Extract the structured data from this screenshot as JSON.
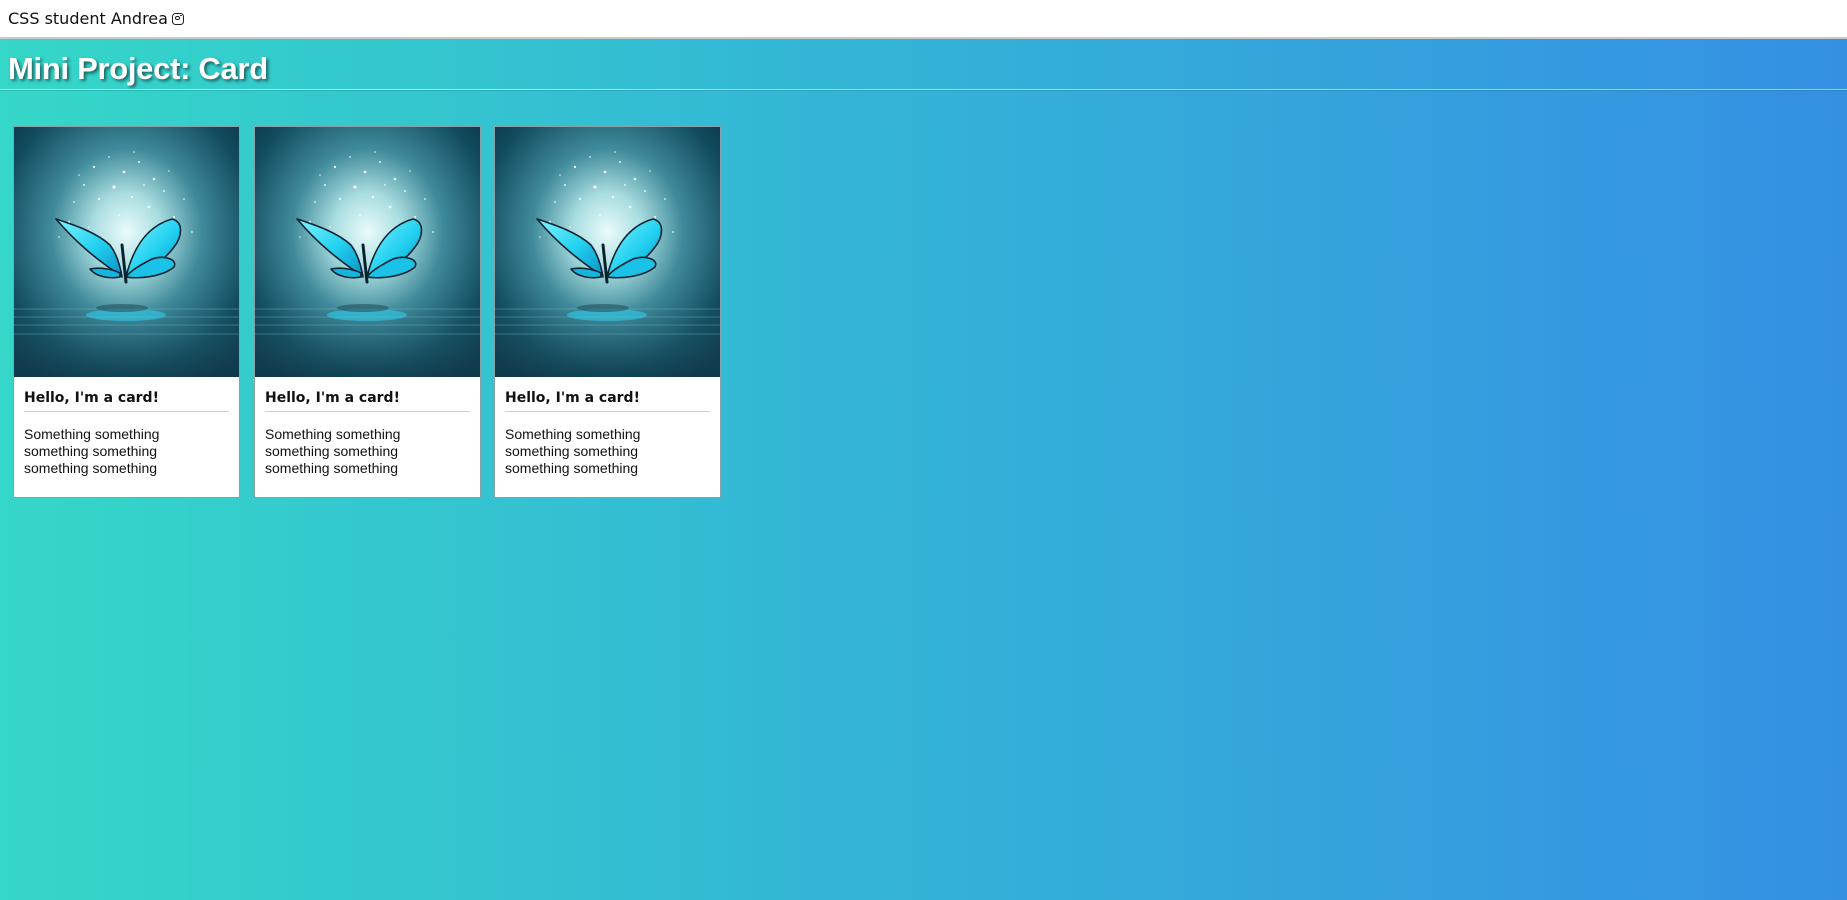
{
  "header": {
    "text": "CSS student Andrea",
    "icon": "instagram-icon"
  },
  "page": {
    "title": "Mini Project: Card"
  },
  "cards": [
    {
      "title": "Hello, I'm a card!",
      "text": "Something something something something something something",
      "image": "butterfly-image"
    },
    {
      "title": "Hello, I'm a card!",
      "text": "Something something something something something something",
      "image": "butterfly-image"
    },
    {
      "title": "Hello, I'm a card!",
      "text": "Something something something something something something",
      "image": "butterfly-image"
    }
  ],
  "colors": {
    "gradient_start": "#35d7c8",
    "gradient_end": "#3590e4",
    "butterfly": "#2fd3f0"
  }
}
